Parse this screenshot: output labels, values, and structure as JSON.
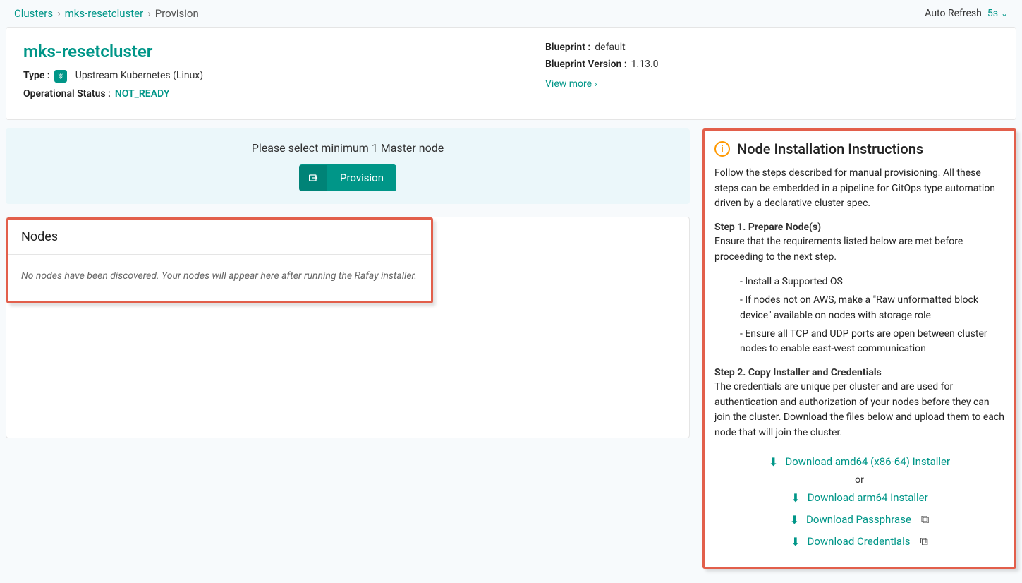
{
  "breadcrumb": {
    "root": "Clusters",
    "cluster": "mks-resetcluster",
    "current": "Provision"
  },
  "autoRefresh": {
    "label": "Auto Refresh",
    "interval": "5s"
  },
  "header": {
    "clusterName": "mks-resetcluster",
    "typeLabel": "Type :",
    "typeValue": "Upstream Kubernetes (Linux)",
    "opStatusLabel": "Operational Status :",
    "opStatusValue": "NOT_READY",
    "blueprintLabel": "Blueprint :",
    "blueprintValue": "default",
    "blueprintVersionLabel": "Blueprint Version :",
    "blueprintVersionValue": "1.13.0",
    "viewMore": "View more"
  },
  "provision": {
    "message": "Please select minimum 1 Master node",
    "button": "Provision"
  },
  "nodes": {
    "title": "Nodes",
    "empty": "No nodes have been discovered. Your nodes will appear here after running the Rafay installer."
  },
  "instructions": {
    "title": "Node Installation Instructions",
    "intro": "Follow the steps described for manual provisioning. All these steps can be embedded in a pipeline for GitOps type automation driven by a declarative cluster spec.",
    "step1Title": "Step 1. Prepare Node(s)",
    "step1Text": "Ensure that the requirements listed below are met before proceeding to the next step.",
    "step1Items": [
      "Install a Supported OS",
      "If nodes not on AWS, make a \"Raw unformatted block device\" available on nodes with storage role",
      "Ensure all TCP and UDP ports are open between cluster nodes to enable east-west communication"
    ],
    "step2Title": "Step 2. Copy Installer and Credentials",
    "step2Text": "The credentials are unique per cluster and are used for authentication and authorization of your nodes before they can join the cluster. Download the files below and upload them to each node that will join the cluster.",
    "downloads": {
      "amd64": "Download amd64 (x86-64) Installer",
      "or": "or",
      "arm64": "Download arm64 Installer",
      "passphrase": "Download Passphrase",
      "credentials": "Download Credentials"
    }
  }
}
